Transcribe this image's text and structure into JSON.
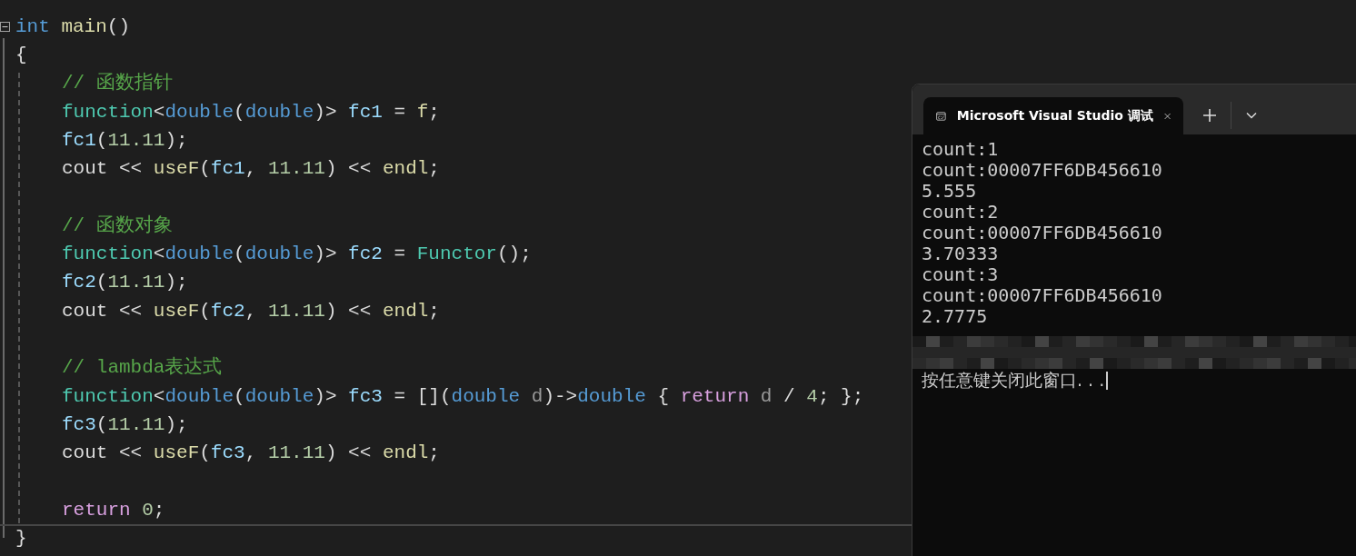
{
  "editor": {
    "signature": [
      {
        "t": "int",
        "kind": "keyword"
      },
      {
        "t": " main",
        "kind": "func"
      },
      {
        "t": "()",
        "kind": "plain"
      }
    ],
    "open": [
      {
        "t": "{",
        "kind": "plain"
      }
    ],
    "body": [
      {
        "kind": "code",
        "tokens": [
          {
            "t": "// 函数指针",
            "kind": "comment"
          }
        ]
      },
      {
        "kind": "code",
        "tokens": [
          {
            "t": "function",
            "kind": "type"
          },
          {
            "t": "<",
            "kind": "plain"
          },
          {
            "t": "double",
            "kind": "keyword"
          },
          {
            "t": "(",
            "kind": "plain"
          },
          {
            "t": "double",
            "kind": "keyword"
          },
          {
            "t": ")> ",
            "kind": "plain"
          },
          {
            "t": "fc1",
            "kind": "var"
          },
          {
            "t": " = ",
            "kind": "plain"
          },
          {
            "t": "f",
            "kind": "func"
          },
          {
            "t": ";",
            "kind": "plain"
          }
        ]
      },
      {
        "kind": "code",
        "tokens": [
          {
            "t": "fc1",
            "kind": "var"
          },
          {
            "t": "(",
            "kind": "plain"
          },
          {
            "t": "11.11",
            "kind": "num"
          },
          {
            "t": ");",
            "kind": "plain"
          }
        ]
      },
      {
        "kind": "code",
        "tokens": [
          {
            "t": "cout << ",
            "kind": "plain"
          },
          {
            "t": "useF",
            "kind": "func"
          },
          {
            "t": "(",
            "kind": "plain"
          },
          {
            "t": "fc1",
            "kind": "var"
          },
          {
            "t": ", ",
            "kind": "plain"
          },
          {
            "t": "11.11",
            "kind": "num"
          },
          {
            "t": ") << ",
            "kind": "plain"
          },
          {
            "t": "endl",
            "kind": "func"
          },
          {
            "t": ";",
            "kind": "plain"
          }
        ]
      },
      {
        "kind": "blank"
      },
      {
        "kind": "code",
        "tokens": [
          {
            "t": "// 函数对象",
            "kind": "comment"
          }
        ]
      },
      {
        "kind": "code",
        "tokens": [
          {
            "t": "function",
            "kind": "type"
          },
          {
            "t": "<",
            "kind": "plain"
          },
          {
            "t": "double",
            "kind": "keyword"
          },
          {
            "t": "(",
            "kind": "plain"
          },
          {
            "t": "double",
            "kind": "keyword"
          },
          {
            "t": ")> ",
            "kind": "plain"
          },
          {
            "t": "fc2",
            "kind": "var"
          },
          {
            "t": " = ",
            "kind": "plain"
          },
          {
            "t": "Functor",
            "kind": "type"
          },
          {
            "t": "();",
            "kind": "plain"
          }
        ]
      },
      {
        "kind": "code",
        "tokens": [
          {
            "t": "fc2",
            "kind": "var"
          },
          {
            "t": "(",
            "kind": "plain"
          },
          {
            "t": "11.11",
            "kind": "num"
          },
          {
            "t": ");",
            "kind": "plain"
          }
        ]
      },
      {
        "kind": "code",
        "tokens": [
          {
            "t": "cout << ",
            "kind": "plain"
          },
          {
            "t": "useF",
            "kind": "func"
          },
          {
            "t": "(",
            "kind": "plain"
          },
          {
            "t": "fc2",
            "kind": "var"
          },
          {
            "t": ", ",
            "kind": "plain"
          },
          {
            "t": "11.11",
            "kind": "num"
          },
          {
            "t": ") << ",
            "kind": "plain"
          },
          {
            "t": "endl",
            "kind": "func"
          },
          {
            "t": ";",
            "kind": "plain"
          }
        ]
      },
      {
        "kind": "blank"
      },
      {
        "kind": "code",
        "tokens": [
          {
            "t": "// lambda表达式",
            "kind": "comment"
          }
        ]
      },
      {
        "kind": "code",
        "tokens": [
          {
            "t": "function",
            "kind": "type"
          },
          {
            "t": "<",
            "kind": "plain"
          },
          {
            "t": "double",
            "kind": "keyword"
          },
          {
            "t": "(",
            "kind": "plain"
          },
          {
            "t": "double",
            "kind": "keyword"
          },
          {
            "t": ")> ",
            "kind": "plain"
          },
          {
            "t": "fc3",
            "kind": "var"
          },
          {
            "t": " = [](",
            "kind": "plain"
          },
          {
            "t": "double",
            "kind": "keyword"
          },
          {
            "t": " d",
            "kind": "param"
          },
          {
            "t": ")->",
            "kind": "plain"
          },
          {
            "t": "double",
            "kind": "keyword"
          },
          {
            "t": " { ",
            "kind": "plain"
          },
          {
            "t": "return",
            "kind": "control"
          },
          {
            "t": " d",
            "kind": "param"
          },
          {
            "t": " / ",
            "kind": "plain"
          },
          {
            "t": "4",
            "kind": "num"
          },
          {
            "t": "; };",
            "kind": "plain"
          }
        ]
      },
      {
        "kind": "code",
        "tokens": [
          {
            "t": "fc3",
            "kind": "var"
          },
          {
            "t": "(",
            "kind": "plain"
          },
          {
            "t": "11.11",
            "kind": "num"
          },
          {
            "t": ");",
            "kind": "plain"
          }
        ]
      },
      {
        "kind": "code",
        "tokens": [
          {
            "t": "cout << ",
            "kind": "plain"
          },
          {
            "t": "useF",
            "kind": "func"
          },
          {
            "t": "(",
            "kind": "plain"
          },
          {
            "t": "fc3",
            "kind": "var"
          },
          {
            "t": ", ",
            "kind": "plain"
          },
          {
            "t": "11.11",
            "kind": "num"
          },
          {
            "t": ") << ",
            "kind": "plain"
          },
          {
            "t": "endl",
            "kind": "func"
          },
          {
            "t": ";",
            "kind": "plain"
          }
        ]
      },
      {
        "kind": "blank"
      },
      {
        "kind": "code",
        "tokens": [
          {
            "t": "return",
            "kind": "control"
          },
          {
            "t": " 0",
            "kind": "num"
          },
          {
            "t": ";",
            "kind": "plain"
          }
        ]
      }
    ],
    "close": [
      {
        "t": "}",
        "kind": "plain"
      }
    ]
  },
  "terminal": {
    "tab": {
      "title": "Microsoft Visual Studio 调试",
      "selected": true
    },
    "output": [
      "count:1",
      "count:00007FF6DB456610",
      "5.555",
      "count:2",
      "count:00007FF6DB456610",
      "3.70333",
      "count:3",
      "count:00007FF6DB456610",
      "2.7775"
    ],
    "prompt": "按任意键关闭此窗口. . ."
  }
}
